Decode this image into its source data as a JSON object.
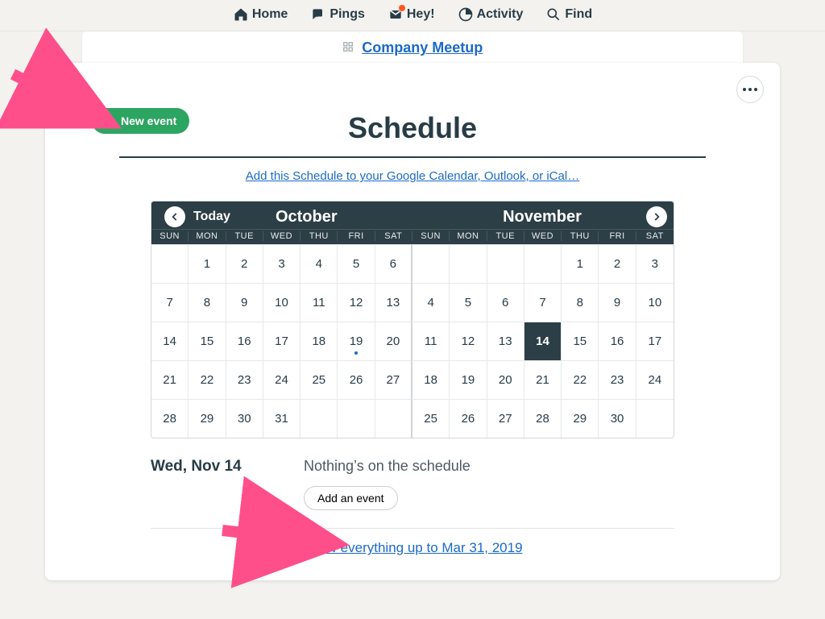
{
  "nav": {
    "home": "Home",
    "pings": "Pings",
    "hey": "Hey!",
    "activity": "Activity",
    "find": "Find"
  },
  "breadcrumb": {
    "label": "Company Meetup"
  },
  "page": {
    "title": "Schedule",
    "new_event": "New event",
    "sync_link": "Add this Schedule to your Google Calendar, Outlook, or iCal…",
    "today": "Today"
  },
  "calendar": {
    "months": {
      "left": "October",
      "right": "November"
    },
    "dow": [
      "SUN",
      "MON",
      "TUE",
      "WED",
      "THU",
      "FRI",
      "SAT",
      "SUN",
      "MON",
      "TUE",
      "WED",
      "THU",
      "FRI",
      "SAT"
    ],
    "rows": [
      [
        "",
        "1",
        "2",
        "3",
        "4",
        "5",
        "6",
        "",
        "",
        "",
        "",
        "1",
        "2",
        "3"
      ],
      [
        "7",
        "8",
        "9",
        "10",
        "11",
        "12",
        "13",
        "4",
        "5",
        "6",
        "7",
        "8",
        "9",
        "10"
      ],
      [
        "14",
        "15",
        "16",
        "17",
        "18",
        "19",
        "20",
        "11",
        "12",
        "13",
        "14",
        "15",
        "16",
        "17"
      ],
      [
        "21",
        "22",
        "23",
        "24",
        "25",
        "26",
        "27",
        "18",
        "19",
        "20",
        "21",
        "22",
        "23",
        "24"
      ],
      [
        "28",
        "29",
        "30",
        "31",
        "",
        "",
        "",
        "25",
        "26",
        "27",
        "28",
        "29",
        "30",
        ""
      ]
    ],
    "selected": {
      "row": 2,
      "col": 10
    },
    "dotted": {
      "row": 2,
      "col": 5
    }
  },
  "agenda": {
    "date": "Wed, Nov 14",
    "empty": "Nothing’s on the schedule",
    "add": "Add an event",
    "show_all": "Show everything up to Mar 31, 2019"
  }
}
